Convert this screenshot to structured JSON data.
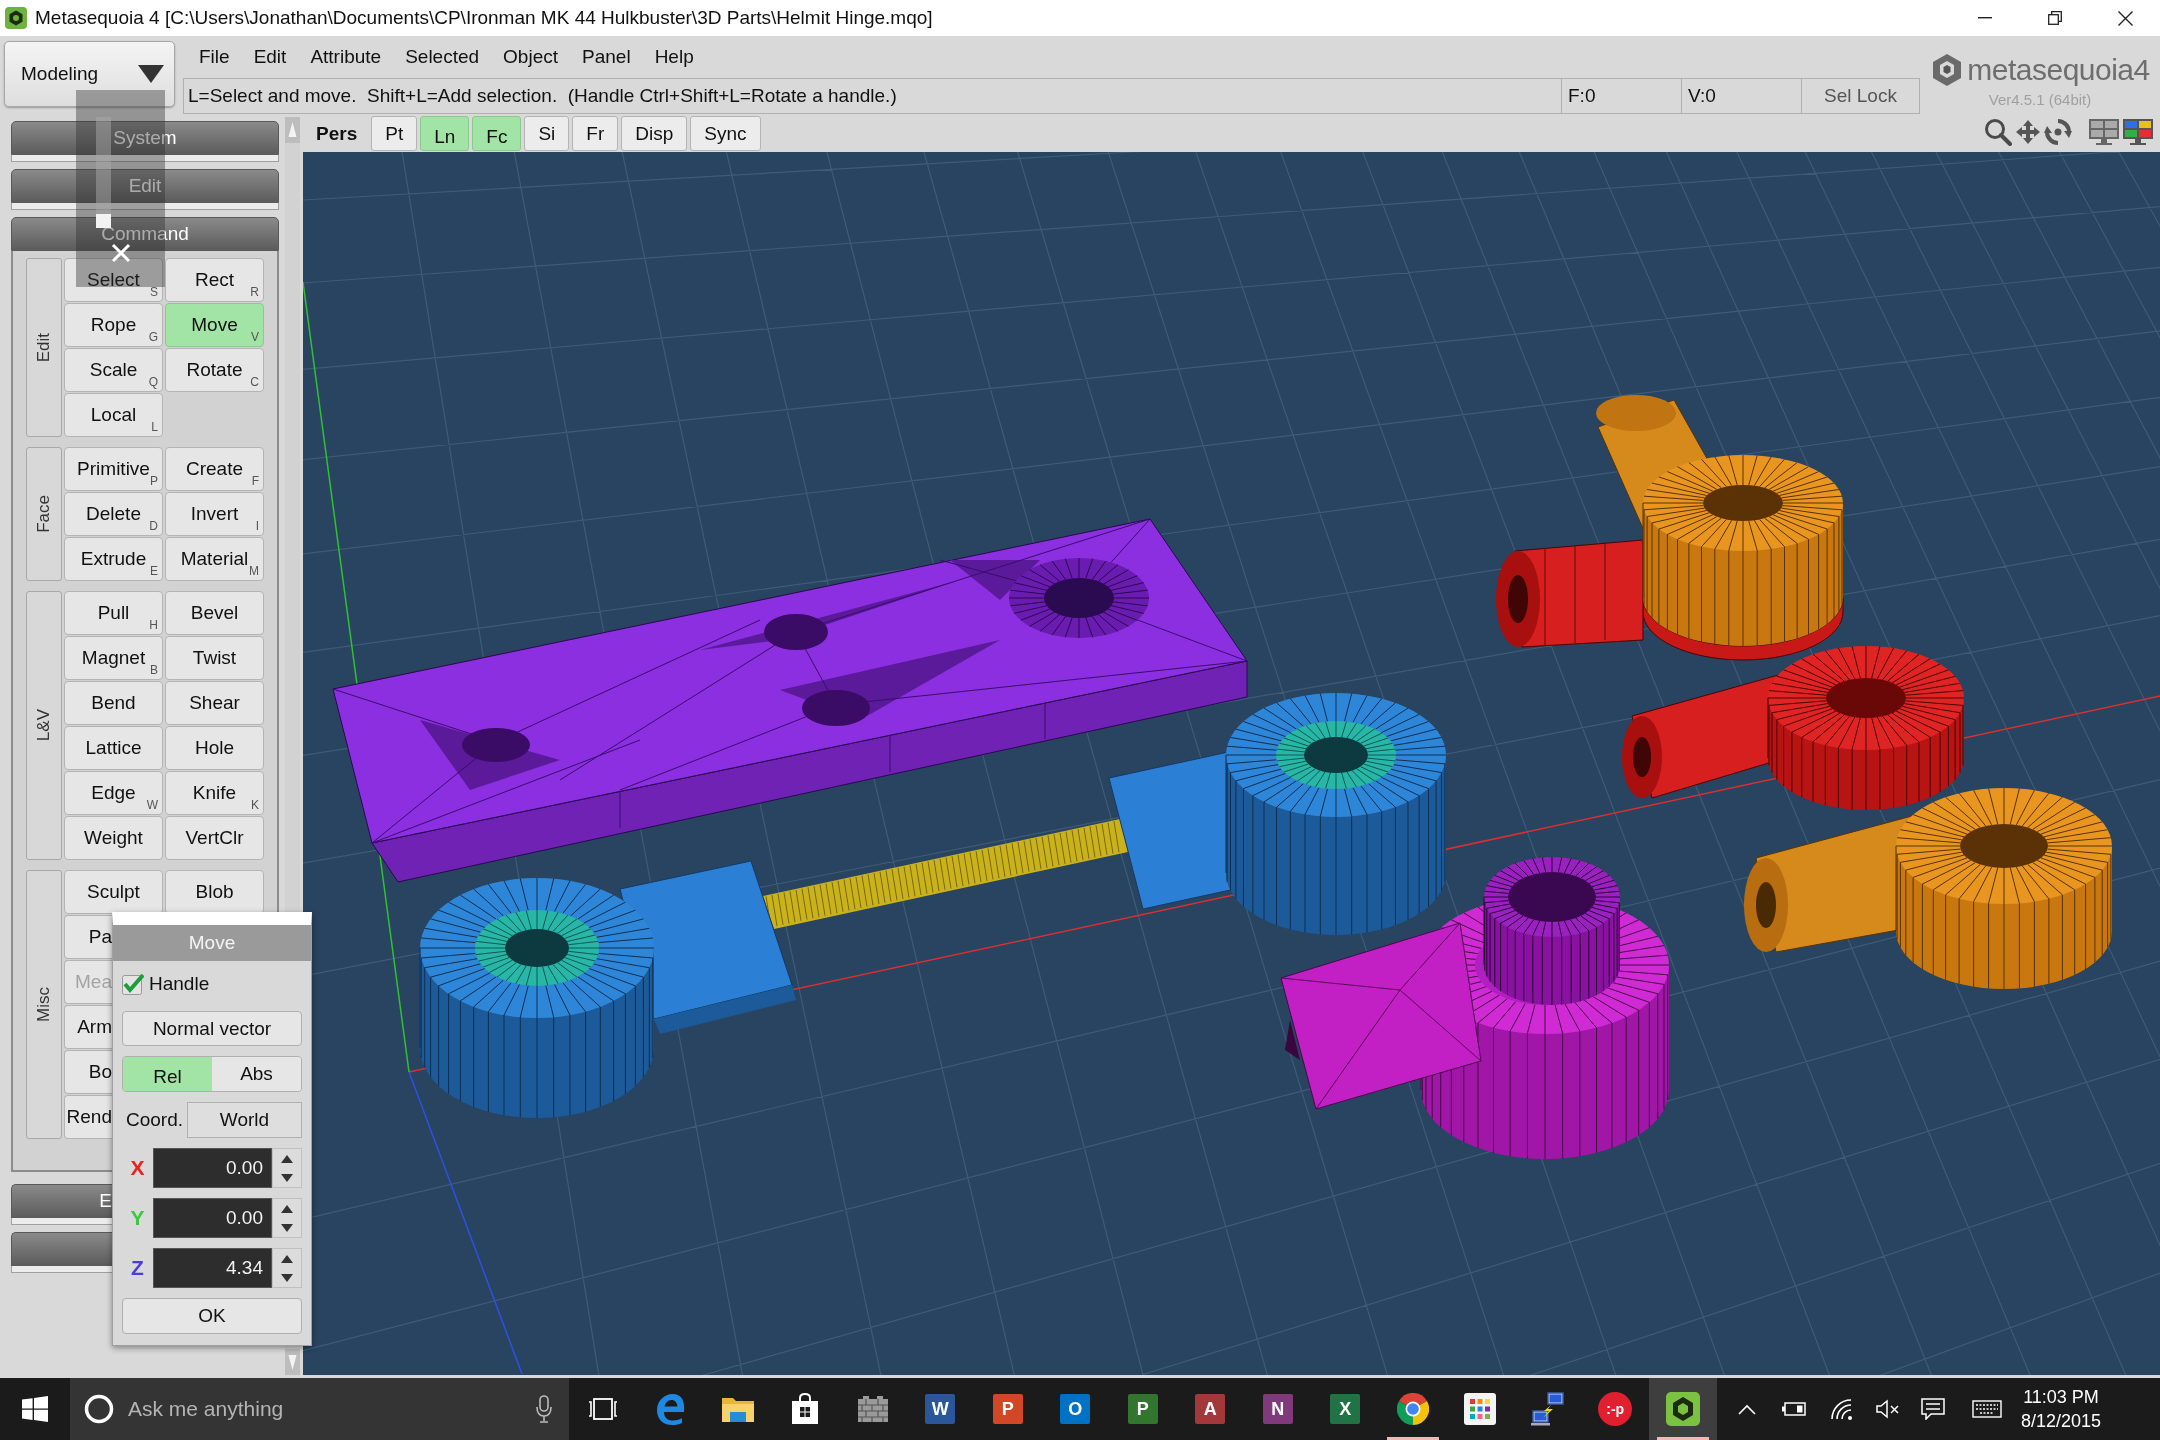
{
  "window": {
    "title": "Metasequoia 4 [C:\\Users\\Jonathan\\Documents\\CP\\Ironman MK 44 Hulkbuster\\3D Parts\\Helmit Hinge.mqo]"
  },
  "mode_dropdown": {
    "value": "Modeling"
  },
  "menu": [
    "File",
    "Edit",
    "Attribute",
    "Selected",
    "Object",
    "Panel",
    "Help"
  ],
  "hint_bar": {
    "text": "L=Select and move.  Shift+L=Add selection.  (Handle Ctrl+Shift+L=Rotate a handle.)",
    "counters": [
      "F:0",
      "V:0"
    ],
    "sel_lock_button": "Sel Lock"
  },
  "logo": {
    "wordmark": "metasequoia4",
    "version": "Ver4.5.1 (64bit)"
  },
  "view_toolbar": [
    {
      "label": "Pers",
      "kind": "label",
      "on": false
    },
    {
      "label": "Pt",
      "kind": "toggle",
      "on": false
    },
    {
      "label": "Ln",
      "kind": "toggle",
      "on": true
    },
    {
      "label": "Fc",
      "kind": "toggle",
      "on": true
    },
    {
      "label": "Si",
      "kind": "toggle",
      "on": false
    },
    {
      "label": "Fr",
      "kind": "toggle",
      "on": false
    },
    {
      "label": "Disp",
      "kind": "toggle",
      "on": false
    },
    {
      "label": "Sync",
      "kind": "toggle",
      "on": false
    }
  ],
  "left_panel": {
    "sections": [
      {
        "title": "System",
        "kind": "header",
        "expanded": false
      },
      {
        "title": "Edit",
        "kind": "header",
        "expanded": false
      },
      {
        "title": "Command",
        "kind": "header",
        "expanded": true,
        "groups": [
          {
            "label": "Edit",
            "buttons": [
              {
                "label": "Select",
                "key": "S",
                "selected": false
              },
              {
                "label": "Rect",
                "key": "R",
                "selected": false
              },
              {
                "label": "Rope",
                "key": "G",
                "selected": false
              },
              {
                "label": "Move",
                "key": "V",
                "selected": true
              },
              {
                "label": "Scale",
                "key": "Q",
                "selected": false
              },
              {
                "label": "Rotate",
                "key": "C",
                "selected": false
              },
              {
                "label": "Local",
                "key": "L",
                "selected": false
              }
            ]
          },
          {
            "label": "Face",
            "buttons": [
              {
                "label": "Primitive",
                "key": "P",
                "selected": false
              },
              {
                "label": "Create",
                "key": "F",
                "selected": false
              },
              {
                "label": "Delete",
                "key": "D",
                "selected": false
              },
              {
                "label": "Invert",
                "key": "I",
                "selected": false
              },
              {
                "label": "Extrude",
                "key": "E",
                "selected": false
              },
              {
                "label": "Material",
                "key": "M",
                "selected": false
              }
            ]
          },
          {
            "label": "L&V",
            "buttons": [
              {
                "label": "Pull",
                "key": "H",
                "selected": false
              },
              {
                "label": "Bevel",
                "selected": false
              },
              {
                "label": "Magnet",
                "key": "B",
                "selected": false
              },
              {
                "label": "Twist",
                "selected": false
              },
              {
                "label": "Bend",
                "selected": false
              },
              {
                "label": "Shear",
                "selected": false
              },
              {
                "label": "Lattice",
                "selected": false
              },
              {
                "label": "Hole",
                "selected": false
              },
              {
                "label": "Edge",
                "key": "W",
                "selected": false
              },
              {
                "label": "Knife",
                "key": "K",
                "selected": false
              },
              {
                "label": "Weight",
                "selected": false
              },
              {
                "label": "VertClr",
                "selected": false
              }
            ]
          },
          {
            "label": "Misc",
            "buttons": [
              {
                "label": "Sculpt",
                "selected": false
              },
              {
                "label": "Blob",
                "selected": false
              }
            ],
            "clipped_buttons": [
              {
                "label": "Pa",
                "disabled": false
              },
              {
                "label": "Mea",
                "disabled": true
              },
              {
                "label": "Arm",
                "disabled": false
              },
              {
                "label": "Bo",
                "disabled": false
              },
              {
                "label": "Rend",
                "disabled": false
              }
            ]
          }
        ]
      },
      {
        "title": "E",
        "kind": "clipped",
        "expanded": false
      },
      {
        "kind": "clipped",
        "expanded": false
      }
    ]
  },
  "move_dialog": {
    "title": "Move",
    "handle": {
      "label": "Handle",
      "checked": true
    },
    "normal_vector_button": "Normal vector",
    "modes": [
      {
        "label": "Rel",
        "selected": true
      },
      {
        "label": "Abs",
        "selected": false
      }
    ],
    "coord": {
      "label": "Coord.",
      "value": "World"
    },
    "axes": [
      {
        "label": "X",
        "value": "0.00",
        "color": "#e82020"
      },
      {
        "label": "Y",
        "value": "0.00",
        "color": "#3cc83c"
      },
      {
        "label": "Z",
        "value": "4.34",
        "color": "#4a3ce0"
      }
    ],
    "ok_button": "OK"
  },
  "taskbar": {
    "search": {
      "placeholder": "Ask me anything"
    },
    "apps": [
      {
        "kind": "edge",
        "running": false,
        "selected": false
      },
      {
        "kind": "folder",
        "running": false,
        "selected": false
      },
      {
        "kind": "store",
        "running": false,
        "selected": false
      },
      {
        "kind": "wall",
        "running": false,
        "selected": false
      },
      {
        "kind": "tile",
        "glyph": "W",
        "color": "#2b579a",
        "running": false,
        "selected": false
      },
      {
        "kind": "tile",
        "glyph": "P",
        "color": "#d24726",
        "running": false,
        "selected": false
      },
      {
        "kind": "tile",
        "glyph": "O",
        "color": "#0072c6",
        "running": false,
        "selected": false
      },
      {
        "kind": "tile",
        "glyph": "P",
        "color": "#31752f",
        "running": false,
        "selected": false
      },
      {
        "kind": "tile",
        "glyph": "A",
        "color": "#a4373a",
        "running": false,
        "selected": false
      },
      {
        "kind": "tile",
        "glyph": "N",
        "color": "#80397b",
        "running": false,
        "selected": false
      },
      {
        "kind": "tile",
        "glyph": "X",
        "color": "#217346",
        "running": false,
        "selected": false
      },
      {
        "kind": "chrome",
        "running": true,
        "selected": false
      },
      {
        "kind": "grid",
        "running": false,
        "selected": false
      },
      {
        "kind": "network",
        "running": false,
        "selected": false
      },
      {
        "kind": "disc",
        "glyph": ":-p",
        "color": "#e0202e",
        "running": false,
        "selected": false
      },
      {
        "kind": "hexagon",
        "running": true,
        "selected": true
      }
    ],
    "clock": {
      "time": "11:03 PM",
      "date": "8/12/2015"
    }
  }
}
